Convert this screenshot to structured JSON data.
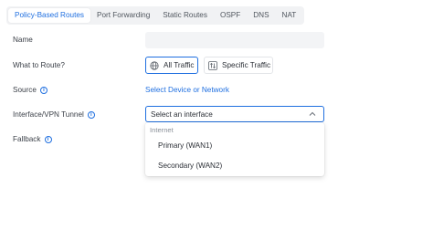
{
  "tabs": [
    {
      "label": "Policy-Based Routes",
      "active": true
    },
    {
      "label": "Port Forwarding",
      "active": false
    },
    {
      "label": "Static Routes",
      "active": false
    },
    {
      "label": "OSPF",
      "active": false
    },
    {
      "label": "DNS",
      "active": false
    },
    {
      "label": "NAT",
      "active": false
    }
  ],
  "form": {
    "name_label": "Name",
    "name_value": "",
    "what_to_route_label": "What to Route?",
    "all_traffic_label": "All Traffic",
    "specific_traffic_label": "Specific Traffic",
    "source_label": "Source",
    "source_link": "Select Device or Network",
    "interface_label": "Interface/VPN Tunnel",
    "interface_placeholder": "Select an interface",
    "fallback_label": "Fallback"
  },
  "dropdown": {
    "group_label": "Internet",
    "options": [
      "Primary (WAN1)",
      "Secondary (WAN2)"
    ]
  },
  "info_icon_glyph": "i",
  "colors": {
    "accent": "#1f6fe0",
    "tab_bar_bg": "#f1f2f4",
    "input_bg": "#f3f4f6"
  }
}
